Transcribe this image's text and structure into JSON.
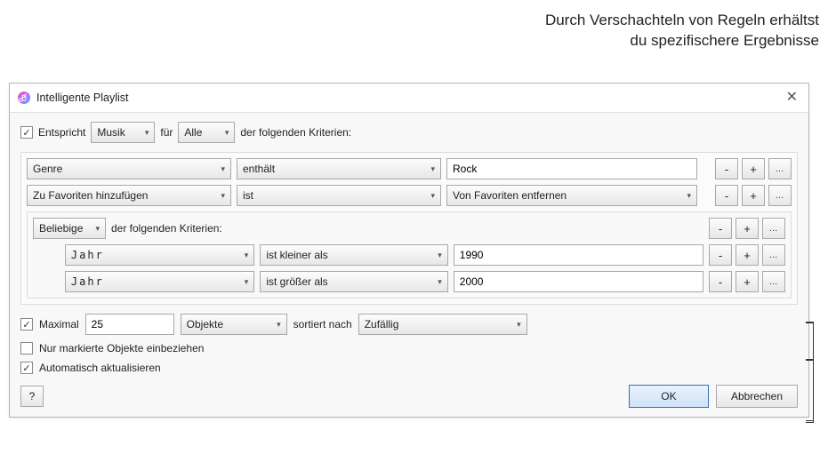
{
  "annotation": {
    "line1": "Durch Verschachteln von Regeln erhältst",
    "line2": "du spezifischere Ergebnisse"
  },
  "window": {
    "title": "Intelligente Playlist"
  },
  "match": {
    "checked": true,
    "label": "Entspricht",
    "media": "Musik",
    "forLabel": "für",
    "scope": "Alle",
    "suffix": "der folgenden Kriterien:"
  },
  "rules": [
    {
      "field": "Genre",
      "op": "enthält",
      "value": "Rock"
    },
    {
      "field": "Zu Favoriten hinzufügen",
      "op": "ist",
      "valueSelect": "Von Favoriten entfernen"
    }
  ],
  "nested": {
    "any": "Beliebige",
    "suffix": "der folgenden Kriterien:",
    "rules": [
      {
        "field": "Jahr",
        "op": "ist kleiner als",
        "value": "1990"
      },
      {
        "field": "Jahr",
        "op": "ist größer als",
        "value": "2000"
      }
    ]
  },
  "limit": {
    "checked": true,
    "label": "Maximal",
    "value": "25",
    "unit": "Objekte",
    "sortLabel": "sortiert nach",
    "sort": "Zufällig"
  },
  "checkedOnly": {
    "checked": false,
    "label": "Nur markierte Objekte einbeziehen"
  },
  "liveUpdate": {
    "checked": true,
    "label": "Automatisch aktualisieren"
  },
  "buttons": {
    "help": "?",
    "ok": "OK",
    "cancel": "Abbrechen",
    "minus": "-",
    "plus": "+",
    "more": "…"
  }
}
